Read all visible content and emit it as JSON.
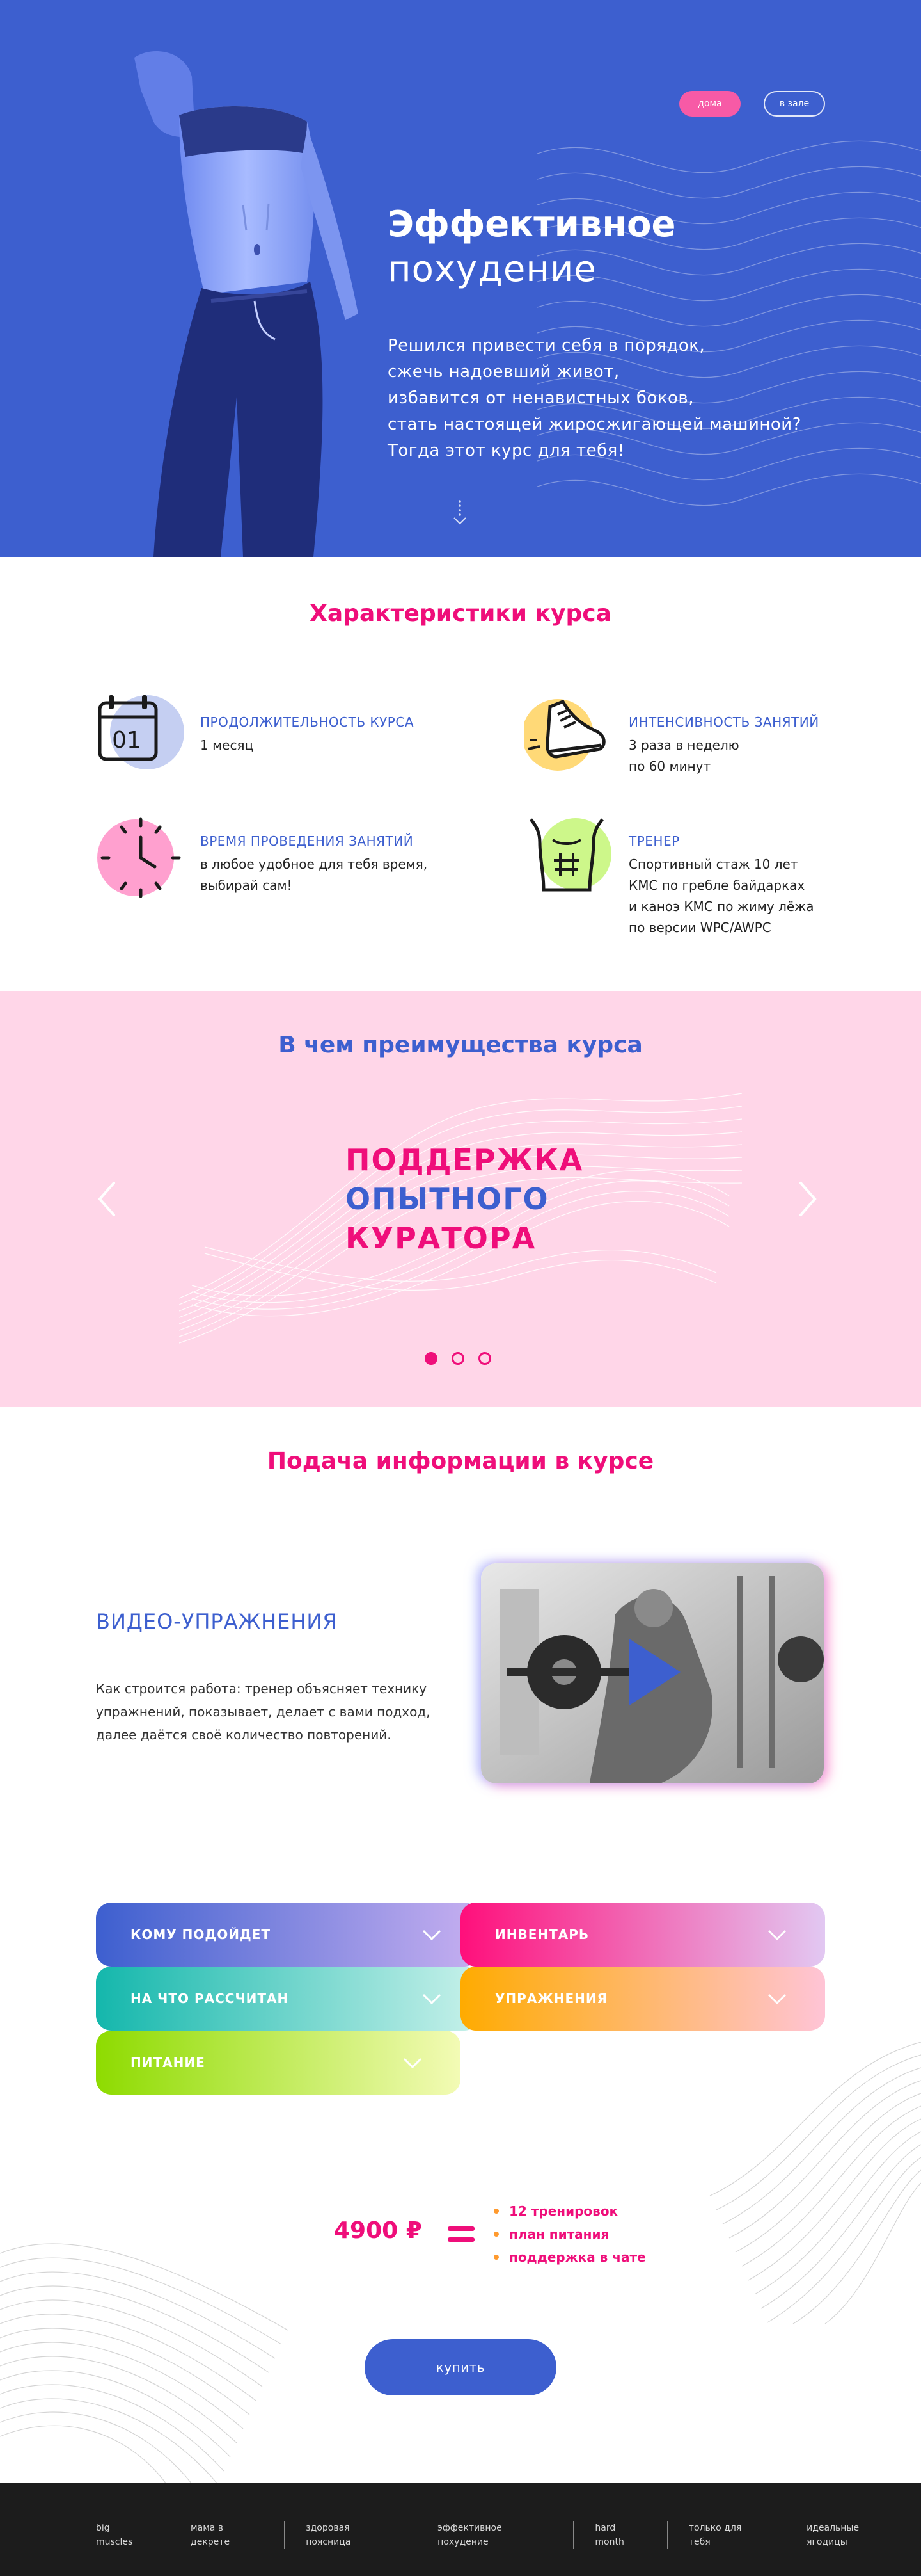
{
  "hero": {
    "toggle_home": "дома",
    "toggle_gym": "в зале",
    "title_bold": "Эффективное",
    "title_light": "похудение",
    "lines": [
      "Решился привести себя в порядок,",
      "сжечь надоевший живот,",
      "избавится от ненавистных боков,",
      "стать настоящей жиросжигающей машиной?",
      "Тогда этот курс для тебя!"
    ],
    "colors": {
      "background": "#3d5fcf",
      "toggle_active": "#f75aa6"
    }
  },
  "characteristics": {
    "title": "Характеристики курса",
    "items": [
      {
        "icon": "calendar-icon",
        "title": "ПРОДОЛЖИТЕЛЬНОСТЬ КУРСА",
        "lines": [
          "1 месяц"
        ]
      },
      {
        "icon": "sneaker-icon",
        "title": "ИНТЕНСИВНОСТЬ ЗАНЯТИЙ",
        "lines": [
          "3 раза в неделю",
          "по 60 минут"
        ]
      },
      {
        "icon": "clock-icon",
        "title": "ВРЕМЯ ПРОВЕДЕНИЯ ЗАНЯТИЙ",
        "lines": [
          "в любое удобное для тебя время,",
          "выбирай сам!"
        ]
      },
      {
        "icon": "torso-icon",
        "title": "ТРЕНЕР",
        "lines": [
          "Спортивный стаж 10 лет",
          "КМС по гребле байдарках",
          "и каноэ КМС по жиму лёжа",
          "по версии WPC/AWPC"
        ]
      }
    ]
  },
  "advantages": {
    "title": "В чем преимущества курса",
    "slide": [
      "ПОДДЕРЖКА",
      "ОПЫТНОГО",
      "КУРАТОРА"
    ],
    "slide_count": 3,
    "active_slide": 1
  },
  "delivery": {
    "title": "Подача информации в курсе",
    "video_title": "ВИДЕО-УПРАЖНЕНИЯ",
    "video_desc": "Как строится работа: тренер объясняет технику упражнений, показывает, делает с вами подход, далее даётся своё количество повторений."
  },
  "accordion": [
    {
      "label": "КОМУ ПОДОЙДЕТ",
      "gradient": [
        "#3d5fcf",
        "#c6aff0"
      ]
    },
    {
      "label": "ИНВЕНТАРЬ",
      "gradient": [
        "#ff0f7b",
        "#e2c8f2"
      ]
    },
    {
      "label": "НА ЧТО РАССЧИТАН",
      "gradient": [
        "#14b7ac",
        "#c7f1ea"
      ]
    },
    {
      "label": "УПРАЖНЕНИЯ",
      "gradient": [
        "#ffab00",
        "#ffc4d6"
      ]
    },
    {
      "label": "ПИТАНИЕ",
      "gradient": [
        "#8edb00",
        "#f3fbb5"
      ]
    }
  ],
  "pricing": {
    "price": "4900 ₽",
    "includes": [
      "12 тренировок",
      "план питания",
      "поддержка в чате"
    ],
    "buy_label": "купить"
  },
  "footer": {
    "links": [
      "big muscles",
      "мама в декрете",
      "здоровая поясница",
      "эффективное похудение",
      "hard month",
      "только для тебя",
      "идеальные ягодицы"
    ]
  }
}
